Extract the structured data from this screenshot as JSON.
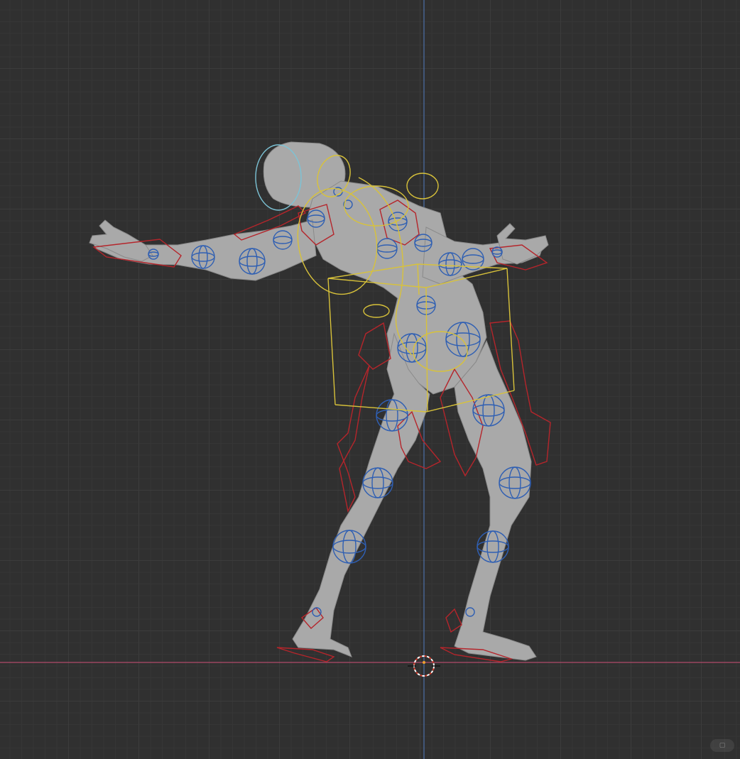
{
  "viewport": {
    "background_color": "#303030",
    "grid_major_color": "#3c3c3c",
    "grid_minor_color": "#363636",
    "axis_z_color": "#4a6fa8",
    "axis_x_color": "#b04a6a"
  },
  "rig": {
    "mesh_color": "#a9a9a9",
    "ik_controls_color": "#b5252b",
    "fk_controls_color": "#2f5fb3",
    "torso_controls_color": "#d8c23a",
    "head_control_color": "#7cc3d6"
  },
  "cursor": {
    "name": "3d-cursor-icon",
    "colors": [
      "#ffffff",
      "#d23c2c"
    ]
  },
  "watermark": {
    "logo": "xiaohongshu-logo"
  }
}
